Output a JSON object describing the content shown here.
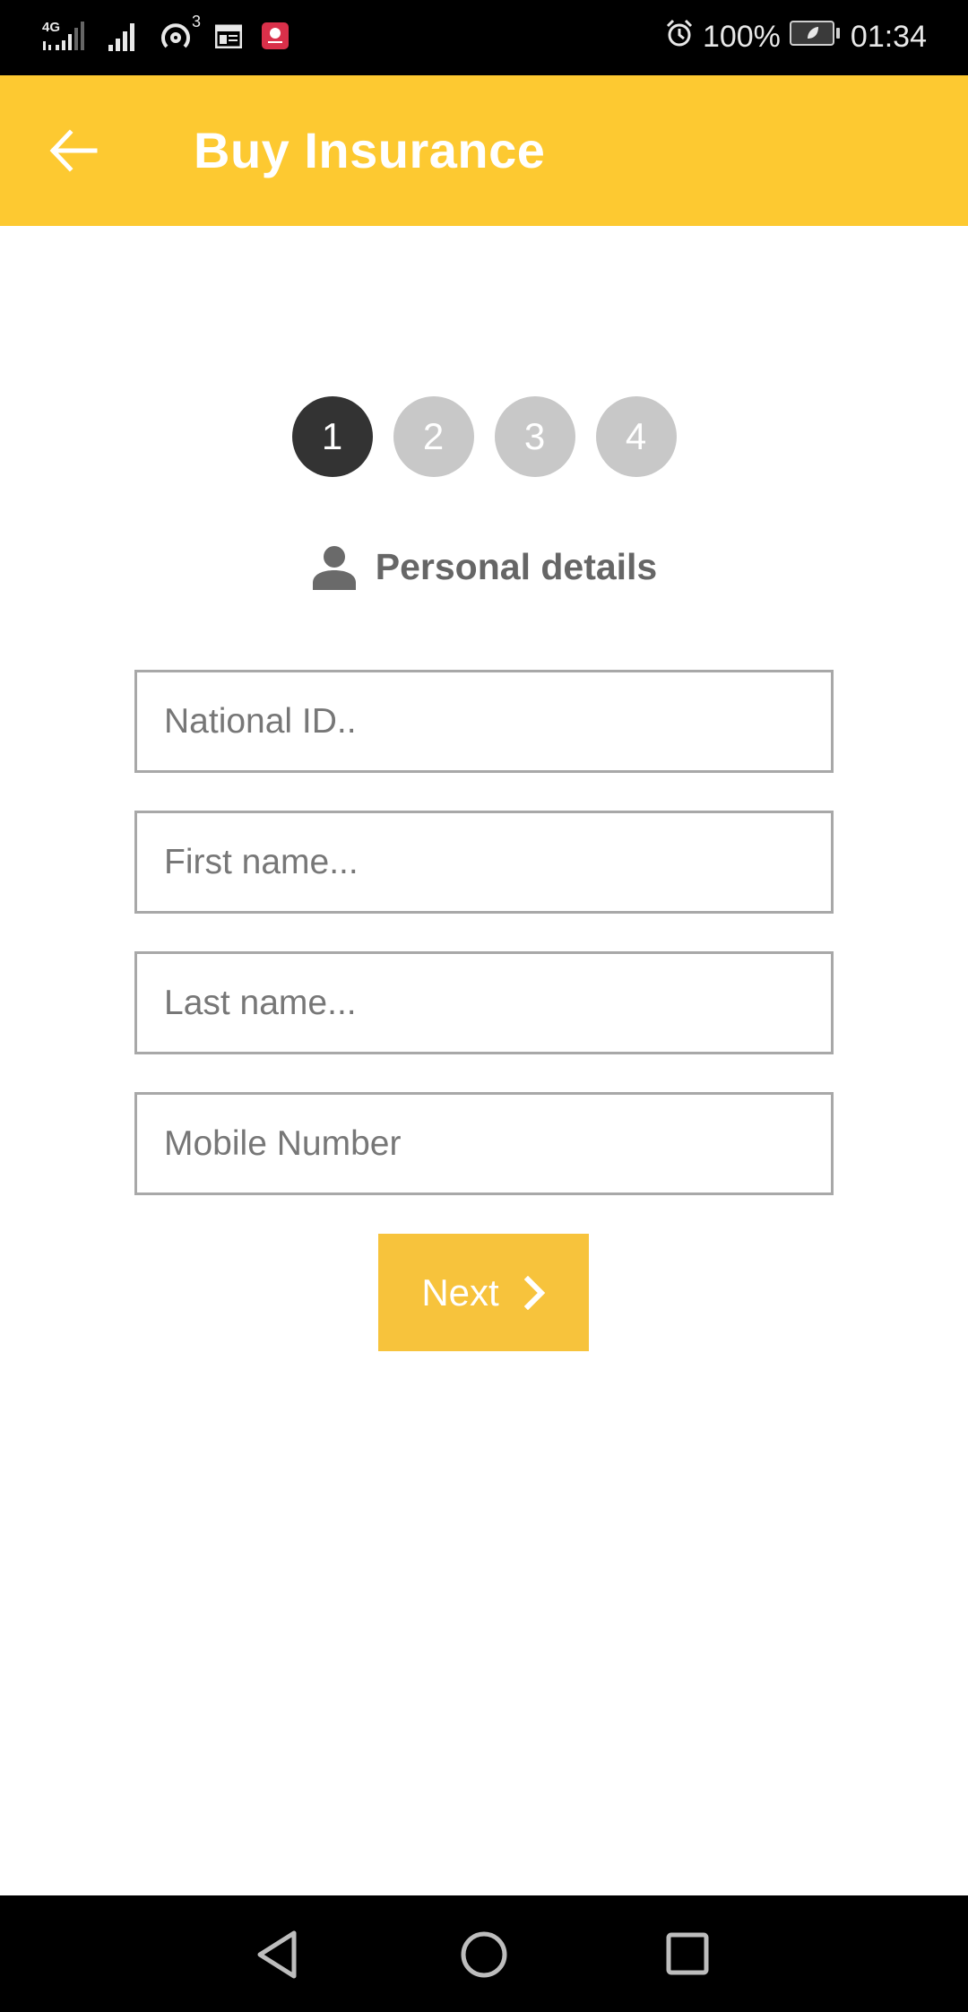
{
  "status_bar": {
    "network_type": "4G",
    "hotspot_count": "3",
    "battery_percent": "100%",
    "time": "01:34",
    "icons": [
      "signal-4g-icon",
      "signal-icon",
      "hotspot-icon",
      "calendar-icon",
      "huawei-app-icon",
      "alarm-icon",
      "battery-saver-icon"
    ]
  },
  "app_bar": {
    "back_icon": "arrow-left-icon",
    "title": "Buy Insurance",
    "background_color": "#fdc931"
  },
  "stepper": {
    "current_step": 1,
    "steps": [
      {
        "label": "1",
        "state": "active"
      },
      {
        "label": "2",
        "state": "inactive"
      },
      {
        "label": "3",
        "state": "inactive"
      },
      {
        "label": "4",
        "state": "inactive"
      }
    ],
    "active_color": "#333333",
    "inactive_color": "#c8c8c8"
  },
  "section": {
    "icon": "person-icon",
    "title": "Personal details"
  },
  "form": {
    "fields": [
      {
        "name": "national-id",
        "value": "",
        "placeholder": "National ID.."
      },
      {
        "name": "first-name",
        "value": "",
        "placeholder": "First name..."
      },
      {
        "name": "last-name",
        "value": "",
        "placeholder": "Last name..."
      },
      {
        "name": "mobile-number",
        "value": "",
        "placeholder": "Mobile Number"
      }
    ],
    "next_button": {
      "label": "Next",
      "icon": "chevron-right-icon",
      "color": "#f7c33c"
    }
  },
  "nav_bar": {
    "buttons": [
      "back-nav-icon",
      "home-nav-icon",
      "recents-nav-icon"
    ]
  }
}
